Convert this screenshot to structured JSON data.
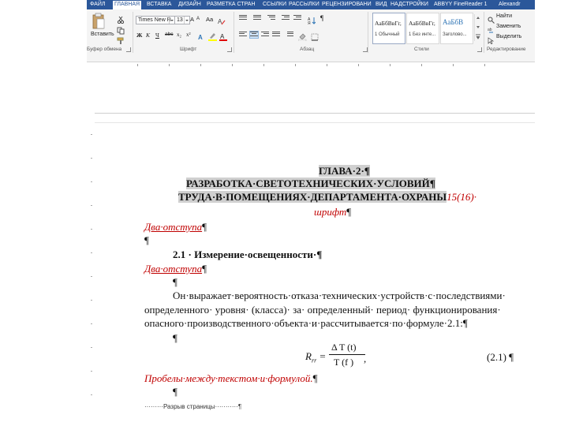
{
  "ribbon": {
    "tabs": [
      "ФАЙЛ",
      "ГЛАВНАЯ",
      "ВСТАВКА",
      "ДИЗАЙН",
      "РАЗМЕТКА СТРАН",
      "ССЫЛКИ",
      "РАССЫЛКИ",
      "РЕЦЕНЗИРОВАНИ",
      "ВИД",
      "НАДСТРОЙКИ",
      "ABBYY FineReader 1",
      "Alexandr"
    ],
    "active_tab": "ГЛАВНАЯ",
    "clipboard": {
      "paste_label": "Вставить",
      "group_label": "Буфер обмена"
    },
    "font": {
      "font_name": "Times New R",
      "font_size": "13",
      "bold": "Ж",
      "italic": "К",
      "underline": "Ч",
      "strike": "abc",
      "subscript": "x₂",
      "superscript": "x²",
      "font_color_letter": "A",
      "group_label": "Шрифт"
    },
    "paragraph": {
      "group_label": "Абзац",
      "pilcrow": "¶"
    },
    "styles": {
      "items": [
        {
          "sample": "АаБбВвГг,",
          "name": "1 Обычный"
        },
        {
          "sample": "АаБбВвГг,",
          "name": "1 Без инте..."
        },
        {
          "sample": "АаБбВ",
          "name": "Заголово..."
        }
      ],
      "group_label": "Стили"
    },
    "editing": {
      "find": "Найти",
      "replace": "Заменить",
      "select": "Выделить",
      "group_label": "Редактирование"
    }
  },
  "document": {
    "heading_line1": "ГЛАВА·2·¶",
    "heading_line2": "РАЗРАБОТКА·СВЕТОТЕХНИЧЕСКИХ·УСЛОВИЙ¶",
    "heading_line3": "ТРУДА·В·ПОМЕЩЕНИЯХ·ДЕПАРТАМЕНТА·ОХРАНЫ",
    "heading_note_a": "15(16)·",
    "heading_note_b": "шрифт",
    "pilcrow": "¶",
    "two_spacing_1": "Два·отступа",
    "section_title": "2.1 · Измерение·освещенности·¶",
    "two_spacing_2": "Два·отступа",
    "body_line1": "Он·выражает·вероятность·отказа·технических·устройств·с·последствиями·",
    "body_line2": "определенного· уровня· (класса)· за· определенный· период· функционирования·",
    "body_line3": "опасного·производственного·объекта·и·рассчитывается·по·формуле·2.1:¶",
    "formula_lhs": "R",
    "formula_sub": "rr",
    "formula_num": "Δ T (t)",
    "formula_den": "T (f )",
    "formula_tail": ",",
    "formula_number": "(2.1) ¶",
    "formula_spacing_note": "Пробелы·между·текстом·и·формулой.",
    "page_break": "·········Разрыв страницы···········¶"
  }
}
